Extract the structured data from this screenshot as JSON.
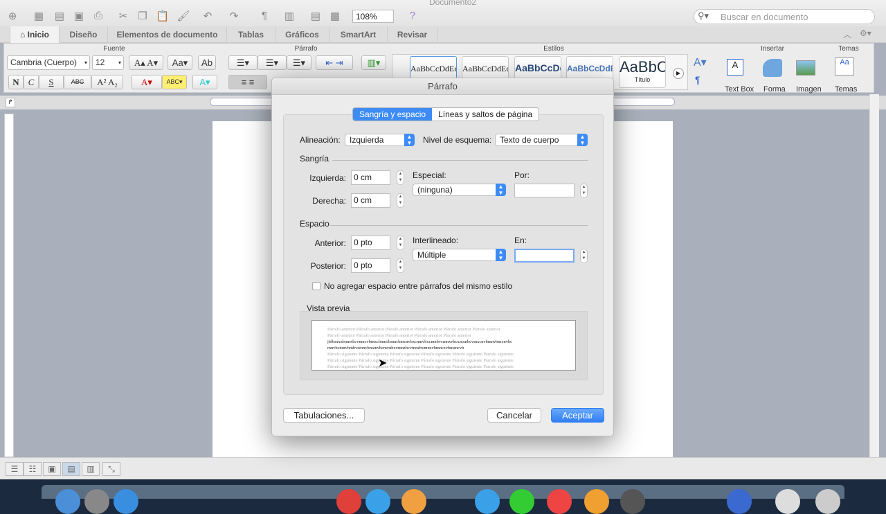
{
  "toolbar": {
    "zoom": "108%",
    "search_placeholder": "Buscar en documento",
    "doc_title": "Documento2"
  },
  "tabs": [
    {
      "label": "Inicio"
    },
    {
      "label": "Diseño"
    },
    {
      "label": "Elementos de documento"
    },
    {
      "label": "Tablas"
    },
    {
      "label": "Gráficos"
    },
    {
      "label": "SmartArt"
    },
    {
      "label": "Revisar"
    }
  ],
  "ribbon": {
    "font_group": "Fuente",
    "font_name": "Cambria (Cuerpo)",
    "font_size": "12",
    "bold": "N",
    "italic": "C",
    "underline": "S",
    "strike": "ABC",
    "paragraph_group": "Párrafo",
    "styles_group": "Estilos",
    "styles": [
      {
        "sample": "AaBbCcDdEe"
      },
      {
        "sample": "AaBbCcDdEe"
      },
      {
        "sample": "AaBbCcDd"
      },
      {
        "sample": "AaBbCcDdEe"
      },
      {
        "sample": "AaBbC",
        "label": "Título"
      }
    ],
    "insert_group": "Insertar",
    "text_box": "Text Box",
    "shape": "Forma",
    "image": "Imagen",
    "themes_group": "Temas",
    "themes": "Temas"
  },
  "dialog": {
    "title": "Párrafo",
    "tabs": [
      {
        "label": "Sangría y espacio",
        "active": true
      },
      {
        "label": "Líneas y saltos de página",
        "active": false
      }
    ],
    "alignment_label": "Alineación:",
    "alignment": "Izquierda",
    "outline_label": "Nivel de esquema:",
    "outline": "Texto de cuerpo",
    "indent_section": "Sangría",
    "left_label": "Izquierda:",
    "left": "0 cm",
    "right_label": "Derecha:",
    "right": "0 cm",
    "special_label": "Especial:",
    "special": "(ninguna)",
    "by_label": "Por:",
    "by": "",
    "spacing_section": "Espacio",
    "before_label": "Anterior:",
    "before": "0 pto",
    "after_label": "Posterior:",
    "after": "0 pto",
    "line_spacing_label": "Interlineado:",
    "line_spacing": "Múltiple",
    "at_label": "En:",
    "at": "",
    "no_space_checkbox": "No agregar espacio entre párrafos del mismo estilo",
    "no_space_checked": false,
    "preview_label": "Vista previa",
    "preview": {
      "prev1": "Párrafo anterior Párrafo anterior Párrafo anterior Párrafo anterior Párrafo anterior Párrafo anterior",
      "prev2": "Párrafo anterior Párrafo anterior Párrafo anterior Párrafo anterior Párrafo anterior",
      "cur1": "jbfbmxnbnmxbcvmncvbmxcbmncbmncbmcnvbxcmnvbxcmnbvcmnxvbcxmxnbcvmxcnvbmnvbmxnvbc",
      "cur2": "mnvbcmnvbmbvzmnvbmznvbcmvnbxvmnzbcvmnzbvmnzvbmnczvbmzncvb",
      "next": "Párrafo siguiente Párrafo siguiente Párrafo siguiente Párrafo siguiente Párrafo siguiente Párrafo siguiente"
    },
    "tabs_button": "Tabulaciones...",
    "cancel": "Cancelar",
    "ok": "Aceptar"
  },
  "colors": {
    "accent": "#3d8cf5",
    "workspace": "#a9b0bb"
  }
}
